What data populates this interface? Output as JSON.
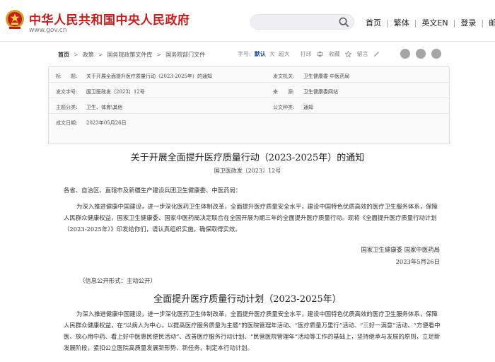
{
  "header": {
    "site_title": "中华人民共和国中央人民政府",
    "site_url": "www.gov.cn",
    "search_placeholder": "",
    "nav": [
      "首页",
      "繁体",
      "英文EN",
      "登录",
      "邮箱"
    ]
  },
  "breadcrumb": [
    "首页",
    "政策",
    "国务院政策文件库",
    "国务院部门文件"
  ],
  "tools": {
    "font_label": "字号:",
    "font_sizes": [
      "默认",
      "大",
      "超大"
    ],
    "active_font": "默认",
    "print": "打印",
    "favorite": "收藏",
    "collapse": "留言"
  },
  "meta": {
    "title_label": "标　　题:",
    "title_value": "关于开展全面提升医疗质量行动（2023-2025年）的通知",
    "issuer_label": "发文机关:",
    "issuer_value": "卫生健康委  中医药局",
    "doc_no_label": "发文字号:",
    "doc_no_value": "国卫医政发〔2023〕12号",
    "source_label": "来　　源:",
    "source_value": "卫生健康委网站",
    "category_label": "主题分类:",
    "category_value": "卫生、体育\\其他",
    "type_label": "公文种类:",
    "type_value": "通知",
    "date_label": "成文日期:",
    "date_value": "2023年05月26日"
  },
  "article": {
    "title": "关于开展全面提升医疗质量行动（2023-2025年）的通知",
    "doc_no": "国卫医政发〔2023〕12号",
    "addressee": "各省、自治区、直辖市及新疆生产建设兵团卫生健康委、中医药局：",
    "body1": "为深入推进健康中国建设，进一步深化医药卫生体制改革，全面提升医疗质量安全水平，建设中国特色优质高效的医疗卫生服务体系，保障人民群众健康权益，国家卫生健康委、国家中医药局决定联合在全国开展为期三年的全面提升医疗质量行动。现将《全面提升医疗质量行动计划（2023-2025年）》印发给你们，请认真组织实施，确保取得实效。",
    "signatory": "国家卫生健康委  国家中医药局",
    "sign_date": "2023年5月26日",
    "disclosure": "（信息公开形式：主动公开）",
    "plan_title": "全面提升医疗质量行动计划（2023-2025年）",
    "body2": "为深入推进健康中国建设，进一步深化医药卫生体制改革，全面提升医疗质量安全水平，建设中国特色优质高效的医疗卫生服务体系，保障人民群众健康权益，在“以病人为中心，以提高医疗服务质量为主题”的医院管理年活动、“医疗质量万里行”活动、“三好一满意”活动、“方便看中医、放心用中药、看上好中医惠民便民活动”、改善医疗服务行动计划、“民营医院管理年”活动等工作的基础上，坚持继承与发展的原则，立足新发展阶段，紧扣公立医院高质量发展新形势、新任务，制定本行动计划。"
  },
  "colors": {
    "brand_red": "#c51c1c",
    "link_blue": "#1a4aa0"
  }
}
